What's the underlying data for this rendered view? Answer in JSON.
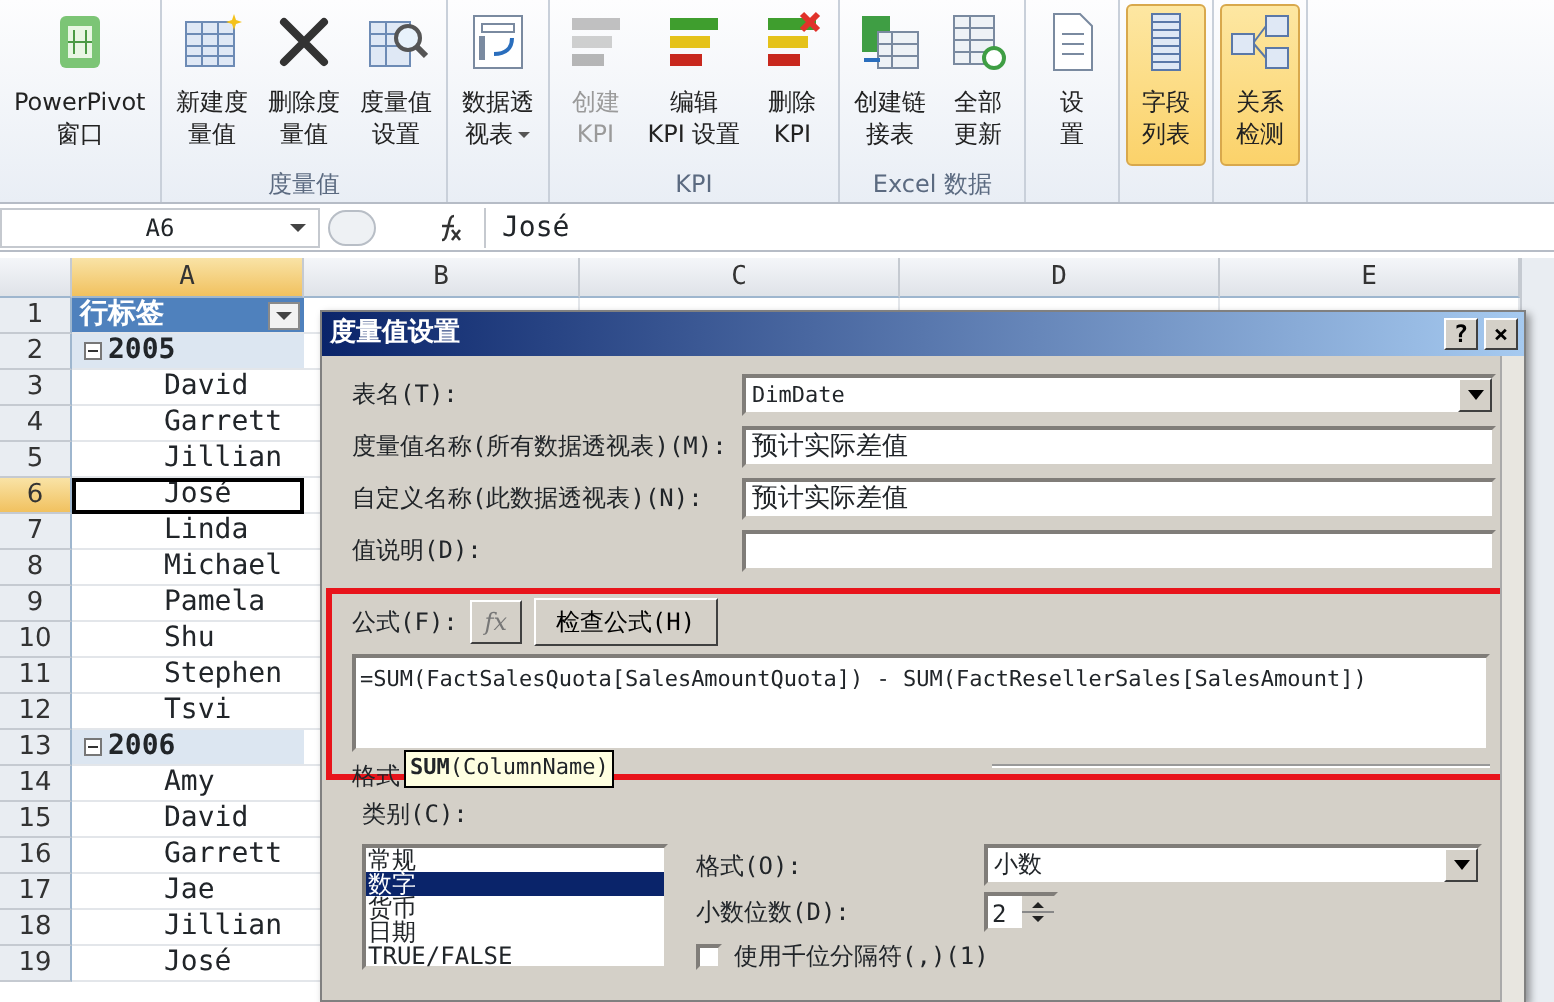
{
  "ribbon": {
    "groups": [
      {
        "buttons": [
          {
            "label": "PowerPivot\n窗口",
            "disabled": false,
            "selected": false,
            "dropdown": false
          }
        ]
      },
      {
        "label": "度量值",
        "buttons": [
          {
            "label": "新建度量值",
            "disabled": false,
            "selected": false,
            "dropdown": false
          },
          {
            "label": "删除度量值",
            "disabled": false,
            "selected": false,
            "dropdown": false
          },
          {
            "label": "度量值设置",
            "disabled": false,
            "selected": false,
            "dropdown": false
          }
        ]
      },
      {
        "buttons": [
          {
            "label": "数据透视表",
            "disabled": false,
            "selected": false,
            "dropdown": true
          }
        ]
      },
      {
        "label": "KPI",
        "buttons": [
          {
            "label": "创建\nKPI",
            "disabled": true,
            "selected": false,
            "dropdown": false
          },
          {
            "label": "编辑\nKPI 设置",
            "disabled": false,
            "selected": false,
            "dropdown": false
          },
          {
            "label": "删除\nKPI",
            "disabled": false,
            "selected": false,
            "dropdown": false
          }
        ]
      },
      {
        "label": "Excel 数据",
        "buttons": [
          {
            "label": "创建链接表",
            "disabled": false,
            "selected": false,
            "dropdown": false
          },
          {
            "label": "全部更新",
            "disabled": false,
            "selected": false,
            "dropdown": false
          }
        ]
      },
      {
        "buttons": [
          {
            "label": "设置",
            "disabled": false,
            "selected": false,
            "dropdown": false
          }
        ]
      },
      {
        "buttons": [
          {
            "label": "字段列表",
            "disabled": false,
            "selected": true,
            "dropdown": false
          }
        ]
      },
      {
        "buttons": [
          {
            "label": "关系检测",
            "disabled": false,
            "selected": true,
            "dropdown": false
          }
        ]
      }
    ]
  },
  "formula_bar": {
    "name_box": "A6",
    "value": "José"
  },
  "sheet": {
    "columns": [
      {
        "label": "A",
        "selected": true
      },
      {
        "label": "B",
        "selected": false
      },
      {
        "label": "C",
        "selected": false
      },
      {
        "label": "D",
        "selected": false
      },
      {
        "label": "E",
        "selected": false
      }
    ],
    "rows": [
      {
        "number": "1",
        "kind": "header",
        "text": "行标签",
        "selected": false
      },
      {
        "number": "2",
        "kind": "group",
        "text": "2005",
        "selected": false,
        "expanded": true
      },
      {
        "number": "3",
        "kind": "item",
        "text": "David",
        "selected": false
      },
      {
        "number": "4",
        "kind": "item",
        "text": "Garrett",
        "selected": false
      },
      {
        "number": "5",
        "kind": "item",
        "text": "Jillian",
        "selected": false
      },
      {
        "number": "6",
        "kind": "item",
        "text": "José",
        "selected": true
      },
      {
        "number": "7",
        "kind": "item",
        "text": "Linda",
        "selected": false
      },
      {
        "number": "8",
        "kind": "item",
        "text": "Michael",
        "selected": false
      },
      {
        "number": "9",
        "kind": "item",
        "text": "Pamela",
        "selected": false
      },
      {
        "number": "10",
        "kind": "item",
        "text": "Shu",
        "selected": false
      },
      {
        "number": "11",
        "kind": "item",
        "text": "Stephen",
        "selected": false
      },
      {
        "number": "12",
        "kind": "item",
        "text": "Tsvi",
        "selected": false
      },
      {
        "number": "13",
        "kind": "group",
        "text": "2006",
        "selected": false,
        "expanded": true
      },
      {
        "number": "14",
        "kind": "item",
        "text": "Amy",
        "selected": false
      },
      {
        "number": "15",
        "kind": "item",
        "text": "David",
        "selected": false
      },
      {
        "number": "16",
        "kind": "item",
        "text": "Garrett",
        "selected": false
      },
      {
        "number": "17",
        "kind": "item",
        "text": "Jae",
        "selected": false
      },
      {
        "number": "18",
        "kind": "item",
        "text": "Jillian",
        "selected": false
      },
      {
        "number": "19",
        "kind": "item",
        "text": "José",
        "selected": false
      }
    ]
  },
  "dialog": {
    "title": "度量值设置",
    "help": "?",
    "close": "×",
    "fields": [
      {
        "label": "表名(T):",
        "kind": "select",
        "value": "DimDate"
      },
      {
        "label": "度量值名称(所有数据透视表)(M):",
        "kind": "text",
        "value": "预计实际差值"
      },
      {
        "label": "自定义名称(此数据透视表)(N):",
        "kind": "text",
        "value": "预计实际差值"
      },
      {
        "label": "值说明(D):",
        "kind": "text"
      }
    ],
    "formula": {
      "label": "公式(F):",
      "fx_button": "fx",
      "check_button": "检查公式(H)",
      "value": "=SUM(FactSalesQuota[SalesAmountQuota]) - SUM(FactResellerSales[SalesAmount])",
      "tooltip_fn": "SUM",
      "tooltip_args": "(ColumnName)",
      "format_label": "格式"
    },
    "category": {
      "label": "类别(C):",
      "items": [
        {
          "text": "常规",
          "selected": false
        },
        {
          "text": "数字",
          "selected": true
        },
        {
          "text": "货币",
          "selected": false
        },
        {
          "text": "日期",
          "selected": false
        },
        {
          "text": "TRUE/FALSE",
          "selected": false
        }
      ]
    },
    "format": {
      "label": "格式(O):",
      "value": "小数"
    },
    "decimals": {
      "label": "小数位数(D):",
      "value": "2"
    },
    "thousands": {
      "label": "使用千位分隔符(,)(1)",
      "checked": false
    }
  }
}
